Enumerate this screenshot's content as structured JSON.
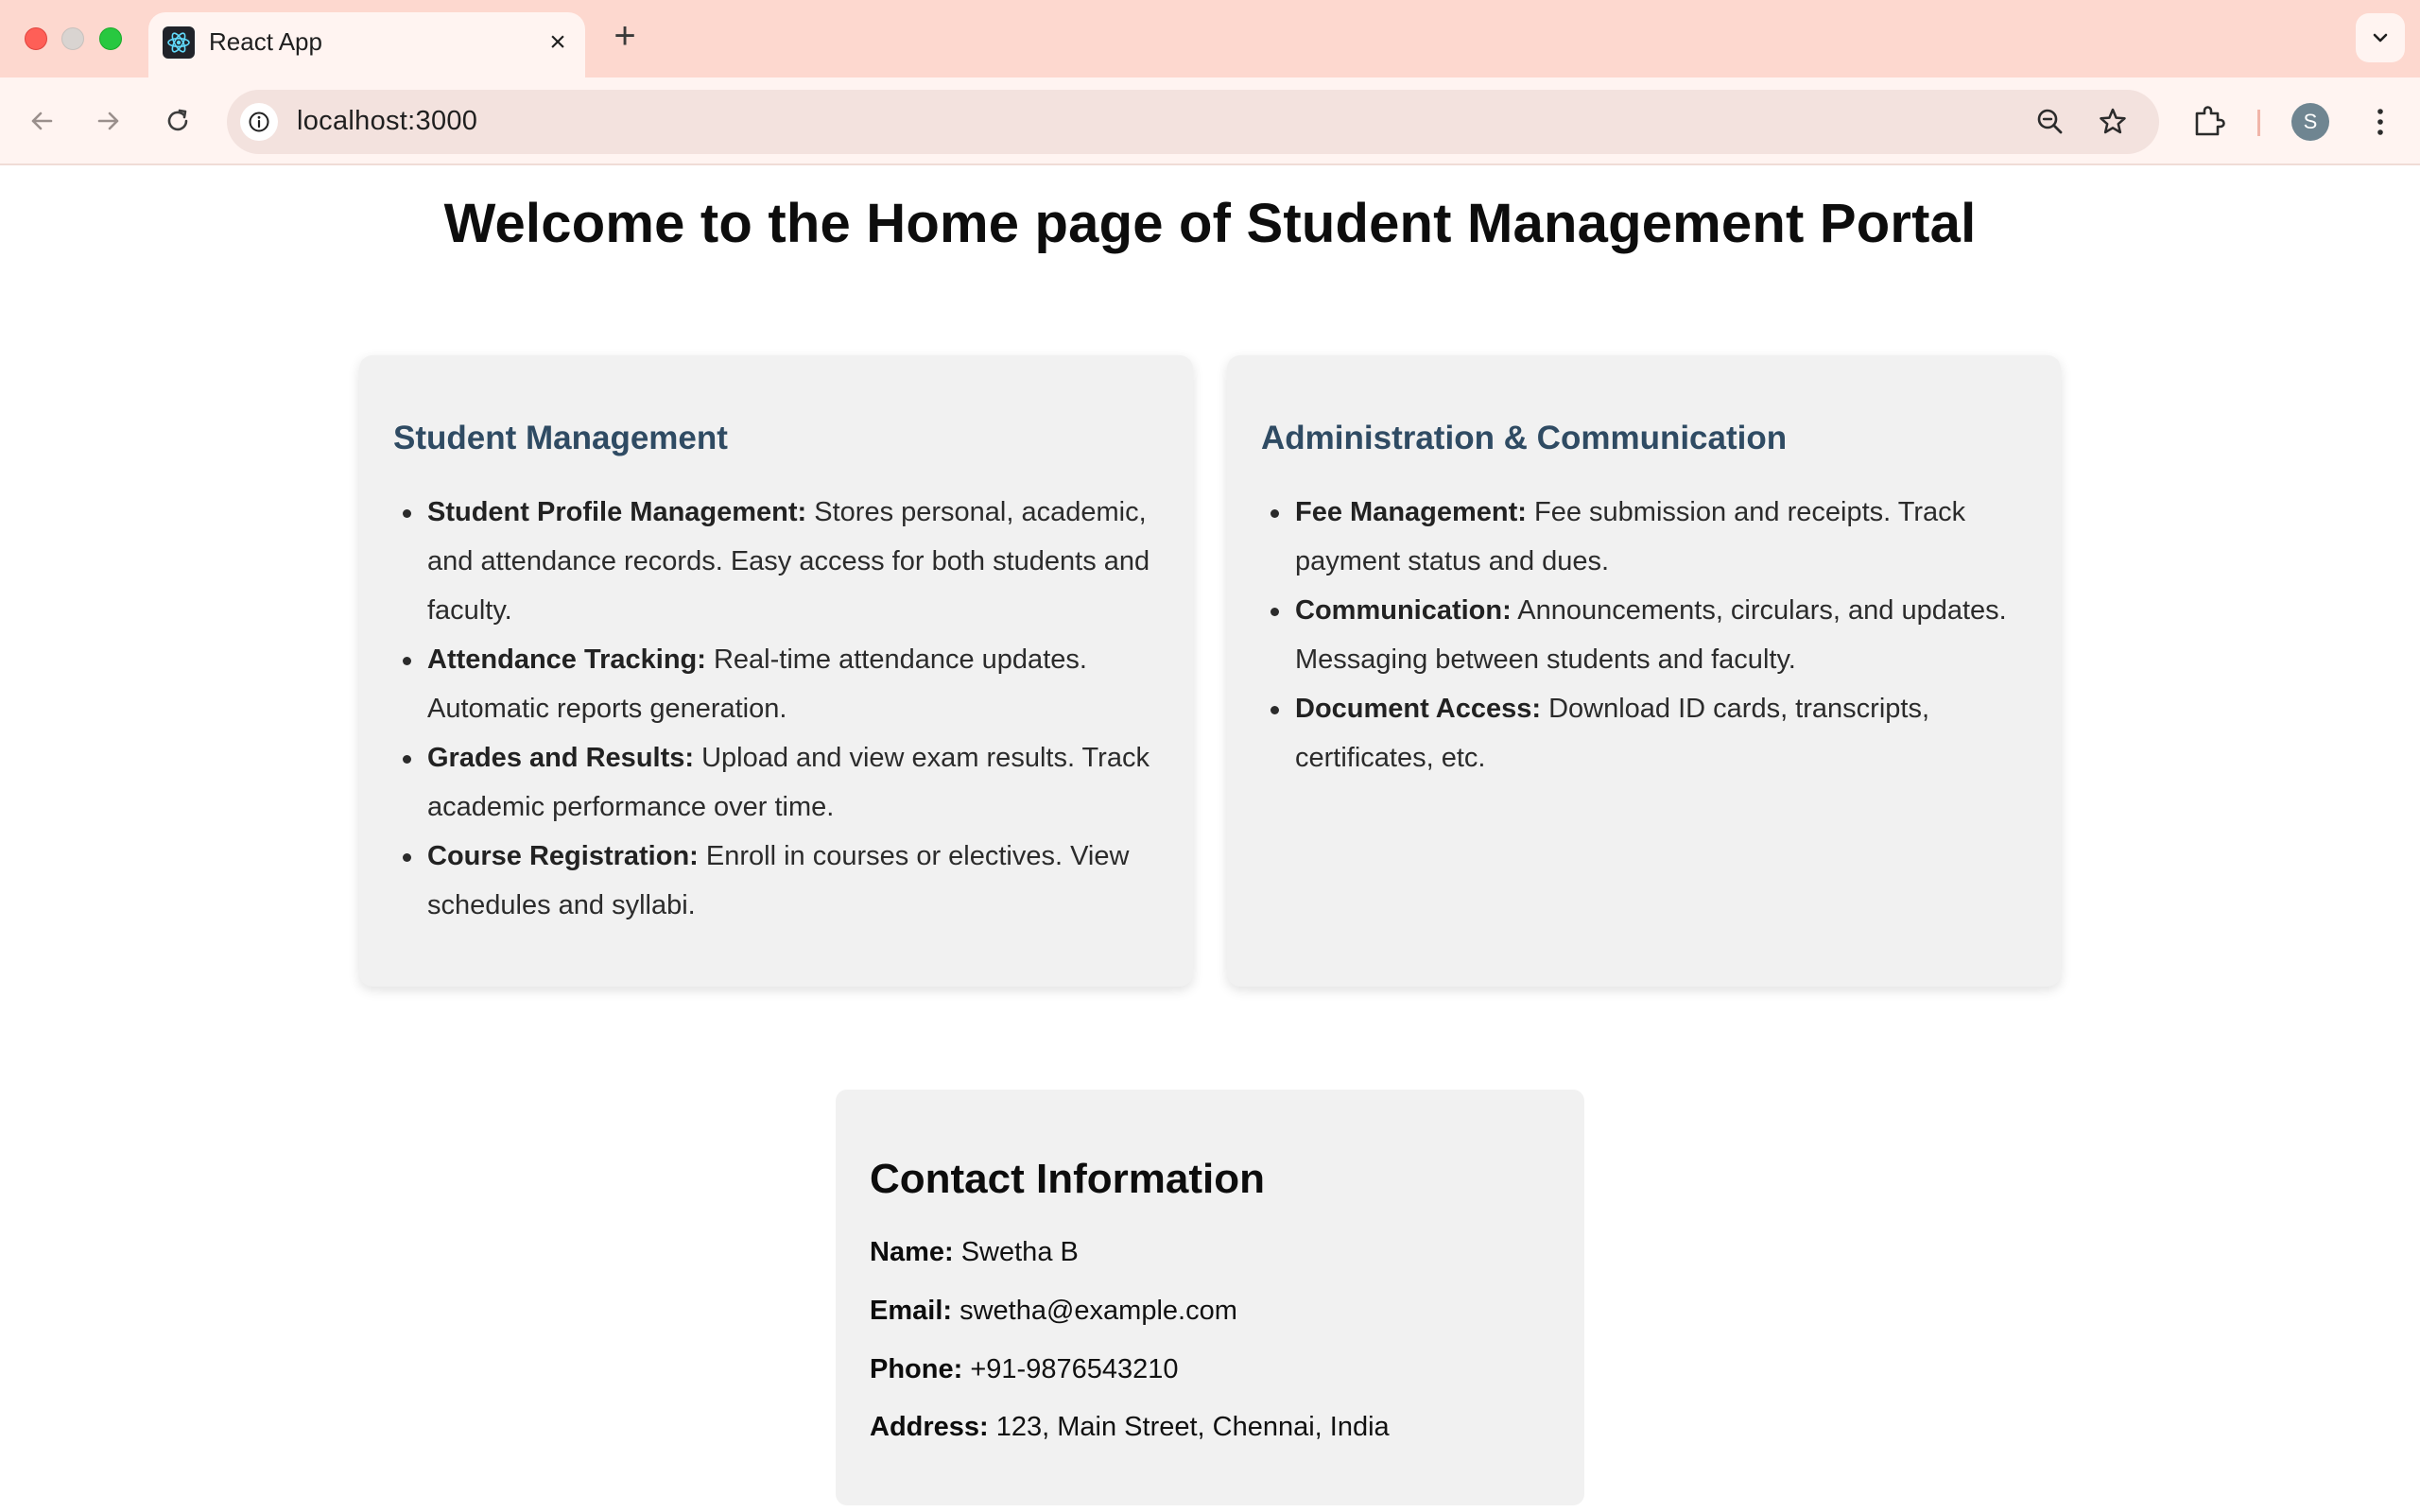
{
  "browser": {
    "tab_title": "React App",
    "url": "localhost:3000",
    "profile_initial": "S"
  },
  "page": {
    "title": "Welcome to the Home page of Student Management Portal"
  },
  "cards": {
    "student": {
      "heading": "Student Management",
      "items": [
        {
          "label": "Student Profile Management:",
          "text": " Stores personal, academic, and attendance records. Easy access for both students and faculty."
        },
        {
          "label": "Attendance Tracking:",
          "text": " Real-time attendance updates. Automatic reports generation."
        },
        {
          "label": "Grades and Results:",
          "text": " Upload and view exam results. Track academic performance over time."
        },
        {
          "label": "Course Registration:",
          "text": " Enroll in courses or electives. View schedules and syllabi."
        }
      ]
    },
    "admin": {
      "heading": "Administration & Communication",
      "items": [
        {
          "label": "Fee Management:",
          "text": " Fee submission and receipts. Track payment status and dues."
        },
        {
          "label": "Communication:",
          "text": " Announcements, circulars, and updates. Messaging between students and faculty."
        },
        {
          "label": "Document Access:",
          "text": " Download ID cards, transcripts, certificates, etc."
        }
      ]
    }
  },
  "contact": {
    "heading": "Contact Information",
    "name_label": "Name:",
    "name": " Swetha B",
    "email_label": "Email:",
    "email": " swetha@example.com",
    "phone_label": "Phone:",
    "phone": " +91-9876543210",
    "address_label": "Address:",
    "address": " 123, Main Street, Chennai, India"
  },
  "icons": {
    "favicon": "react-logo-icon",
    "back": "arrow-left-icon",
    "forward": "arrow-right-icon",
    "reload": "reload-icon",
    "site_info": "info-icon",
    "zoom": "zoom-icon",
    "bookmark": "star-icon",
    "extensions": "puzzle-icon",
    "menu": "kebab-menu-icon",
    "tab_search": "chevron-down-icon"
  },
  "colors": {
    "tabbar_bg": "#fdd8cf",
    "toolbar_bg": "#fff4f1",
    "card_bg": "#f1f1f1",
    "card_heading": "#2f4b63"
  }
}
